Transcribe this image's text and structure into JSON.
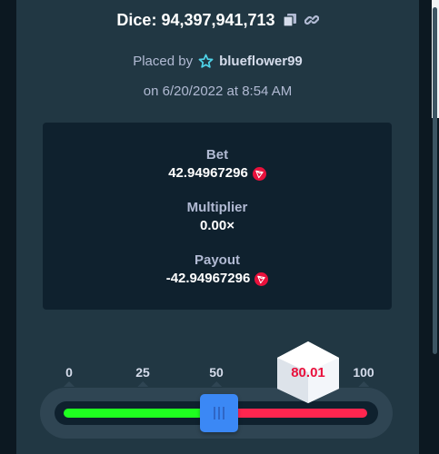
{
  "header": {
    "title": "Dice: 94,397,941,713",
    "copy_icon": "copy-icon",
    "link_icon": "link-icon"
  },
  "placed": {
    "prefix": "Placed by",
    "user_icon": "vip-star-icon",
    "username": "blueflower99"
  },
  "date": "on 6/20/2022 at 8:54 AM",
  "stats": {
    "bet_label": "Bet",
    "bet_value": "42.94967296",
    "multiplier_label": "Multiplier",
    "multiplier_value": "0.00×",
    "payout_label": "Payout",
    "payout_value": "-42.94967296",
    "currency_icon": "tron-icon"
  },
  "slider": {
    "ticks": [
      "0",
      "25",
      "50",
      "",
      "100"
    ],
    "handle_value": 49.5,
    "roll_result": "80.01"
  },
  "colors": {
    "win": "#1fff20",
    "lose": "#ff264f",
    "handle": "#3b88f5",
    "result_text": "#e9113c"
  }
}
